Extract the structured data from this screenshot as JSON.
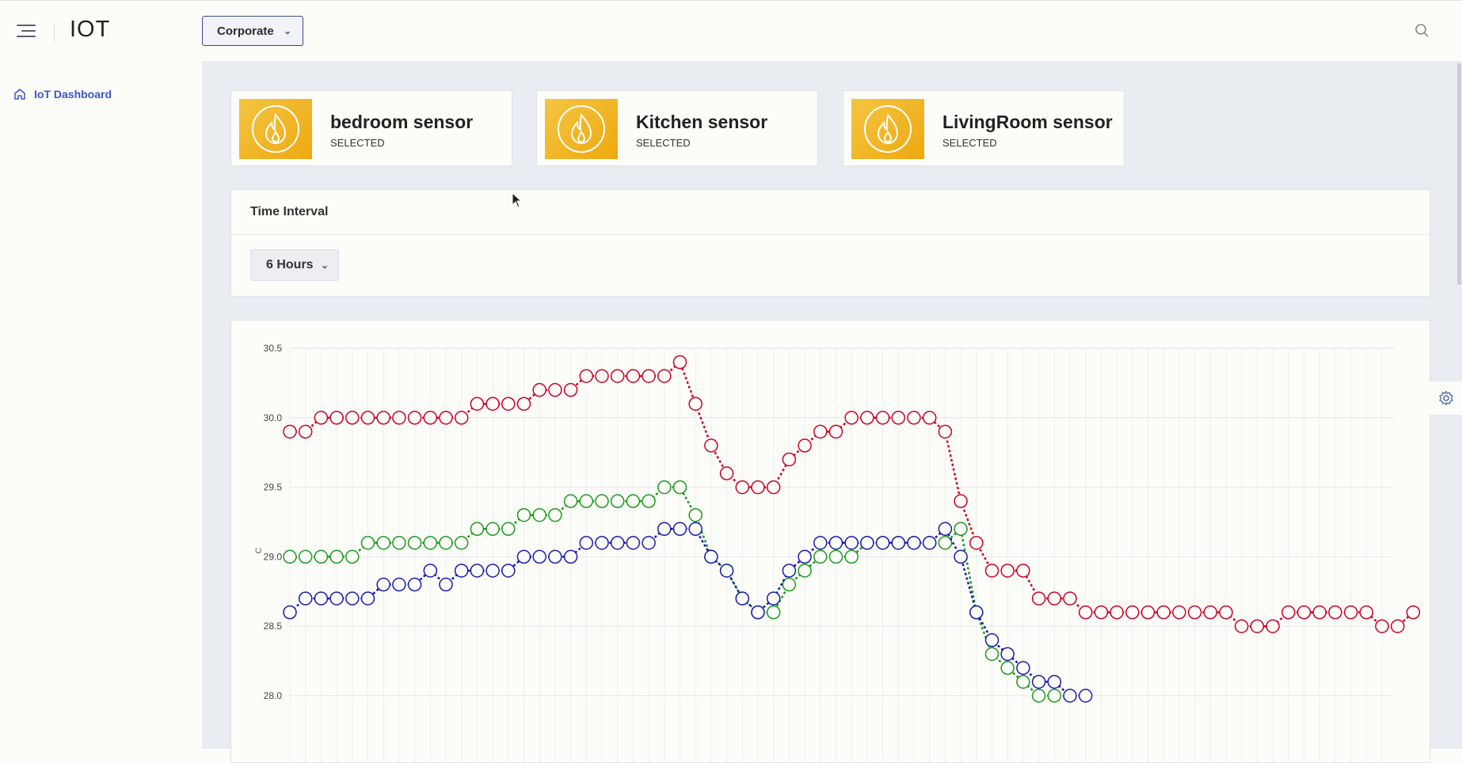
{
  "header": {
    "brand": "IOT",
    "org_select": "Corporate",
    "menu_icon": "hamburger-icon",
    "search_icon": "search-icon"
  },
  "sidebar": {
    "items": [
      {
        "label": "IoT Dashboard",
        "icon": "home-icon"
      }
    ]
  },
  "sensors": [
    {
      "name": "bedroom sensor",
      "status": "SELECTED",
      "icon": "fire-icon"
    },
    {
      "name": "Kitchen sensor",
      "status": "SELECTED",
      "icon": "fire-icon"
    },
    {
      "name": "LivingRoom sensor",
      "status": "SELECTED",
      "icon": "fire-icon"
    }
  ],
  "time_interval": {
    "title": "Time Interval",
    "value": "6 Hours"
  },
  "colors": {
    "accent": "#3a56c6",
    "card_icon": "#f0b21e",
    "red_series": "#cc0022",
    "green_series": "#1a9a1a",
    "blue_series": "#1a1ab0"
  },
  "chart_data": {
    "type": "line",
    "ylabel": "C",
    "yticks": [
      "30.5",
      "30.0",
      "29.5",
      "29.0",
      "28.5",
      "28.0"
    ],
    "ylim": [
      28.0,
      30.5
    ],
    "grid": true,
    "series": [
      {
        "color": "#cc0022",
        "values": [
          29.9,
          29.9,
          30.0,
          30.0,
          30.0,
          30.0,
          30.0,
          30.0,
          30.0,
          30.0,
          30.0,
          30.0,
          30.1,
          30.1,
          30.1,
          30.1,
          30.2,
          30.2,
          30.2,
          30.3,
          30.3,
          30.3,
          30.3,
          30.3,
          30.3,
          30.4,
          30.1,
          29.8,
          29.6,
          29.5,
          29.5,
          29.5,
          29.7,
          29.8,
          29.9,
          29.9,
          30.0,
          30.0,
          30.0,
          30.0,
          30.0,
          30.0,
          29.9,
          29.4,
          29.1,
          28.9,
          28.9,
          28.9,
          28.7,
          28.7,
          28.7,
          28.6,
          28.6,
          28.6,
          28.6,
          28.6,
          28.6,
          28.6,
          28.6,
          28.6,
          28.6,
          28.5,
          28.5,
          28.5,
          28.6,
          28.6,
          28.6,
          28.6,
          28.6,
          28.6,
          28.5,
          28.5,
          28.6
        ]
      },
      {
        "color": "#1a9a1a",
        "values": [
          29.0,
          29.0,
          29.0,
          29.0,
          29.0,
          29.1,
          29.1,
          29.1,
          29.1,
          29.1,
          29.1,
          29.1,
          29.2,
          29.2,
          29.2,
          29.3,
          29.3,
          29.3,
          29.4,
          29.4,
          29.4,
          29.4,
          29.4,
          29.4,
          29.5,
          29.5,
          29.3,
          29.0,
          28.9,
          28.7,
          28.6,
          28.6,
          28.8,
          28.9,
          29.0,
          29.0,
          29.0,
          29.1,
          29.1,
          29.1,
          29.1,
          29.1,
          29.1,
          29.2,
          28.6,
          28.3,
          28.2,
          28.1,
          28.0,
          28.0
        ]
      },
      {
        "color": "#1a1ab0",
        "values": [
          28.6,
          28.7,
          28.7,
          28.7,
          28.7,
          28.7,
          28.8,
          28.8,
          28.8,
          28.9,
          28.8,
          28.9,
          28.9,
          28.9,
          28.9,
          29.0,
          29.0,
          29.0,
          29.0,
          29.1,
          29.1,
          29.1,
          29.1,
          29.1,
          29.2,
          29.2,
          29.2,
          29.0,
          28.9,
          28.7,
          28.6,
          28.7,
          28.9,
          29.0,
          29.1,
          29.1,
          29.1,
          29.1,
          29.1,
          29.1,
          29.1,
          29.1,
          29.2,
          29.0,
          28.6,
          28.4,
          28.3,
          28.2,
          28.1,
          28.1,
          28.0,
          28.0
        ]
      }
    ]
  }
}
